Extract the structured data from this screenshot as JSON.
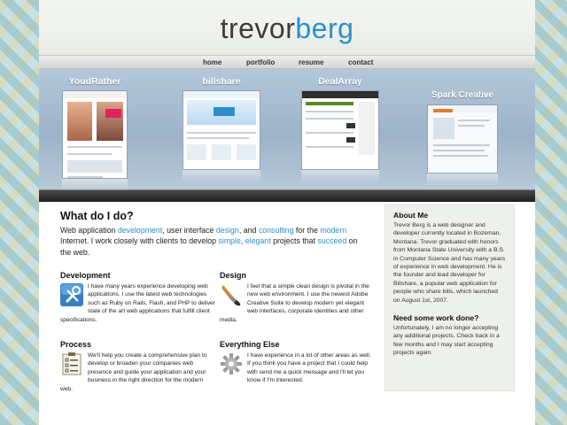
{
  "header": {
    "logo_part1": "trevor",
    "logo_part2": "berg"
  },
  "nav": {
    "items": [
      {
        "label": "home"
      },
      {
        "label": "portfolio"
      },
      {
        "label": "resume"
      },
      {
        "label": "contact"
      }
    ]
  },
  "showcase": {
    "projects": [
      {
        "title": "YoudRather"
      },
      {
        "title": "billshare"
      },
      {
        "title": "DealArray"
      },
      {
        "title": "Spark Creative"
      }
    ]
  },
  "main": {
    "heading": "What do I do?",
    "intro": {
      "t1": "Web application ",
      "k1": "development",
      "t2": ", user interface ",
      "k2": "design",
      "t3": ", and ",
      "k3": "consulting",
      "t4": " for the ",
      "k4": "modern",
      "t5": " Internet. I work closely with clients to develop ",
      "k5": "simple",
      "t6": ", ",
      "k6": "elegant",
      "t7": " projects that ",
      "k7": "succeed",
      "t8": " on the web."
    },
    "features": {
      "development": {
        "title": "Development",
        "text": "I have many years experience developing web applications. I use the latest web technologies such as Ruby on Rails, Flash, and PHP to deliver state of the art web applications that fulfill client specifications."
      },
      "design": {
        "title": "Design",
        "text": "I feel that a simple clean design is pivotal in the new web environment. I use the newest Adobe Creative Suite to develop modern yet elegant web interfaces, corporate identities and other media."
      },
      "process": {
        "title": "Process",
        "text": "We'll help you create a comprehensive plan to develop or broaden your companies web presence and guide your application and your business in the right direction for the modern web."
      },
      "everything_else": {
        "title": "Everything Else",
        "text": "I have experience in a lot of other areas as well. If you think you have a project that I could help with send me a quick message and I'll let you know if I'm interested."
      }
    }
  },
  "sidebar": {
    "about_title": "About Me",
    "about_text": "Trevor Berg is a web designer and developer currently located in Bozeman, Montana. Trevor graduated with honors from Montana State University with a B.S. in Computer Science and has many years of experience in web development. He is the founder and lead developer for Billshare, a popular web application for people who share bills, which launched on August 1st, 2007.",
    "work_title": "Need some work done?",
    "work_text": "Unfortunately, I am no longer accepting any additional projects. Check back in a few months and I may start accepting projects again."
  },
  "icons": {
    "development": "tools-icon",
    "design": "paintbrush-icon",
    "process": "checklist-icon",
    "everything_else": "gear-icon"
  },
  "colors": {
    "accent": "#2b8fcc",
    "text": "#222222",
    "sidebar_bg": "#eef0ec",
    "separator": "#2a2a2a"
  }
}
